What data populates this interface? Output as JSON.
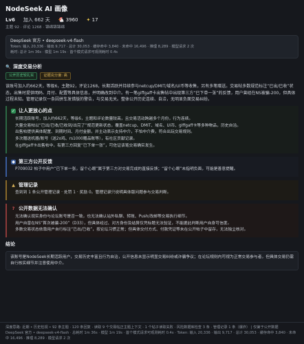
{
  "header": {
    "title": "NodeSeek AI 画像",
    "level": "Lv6",
    "joined": "加入 662 天",
    "chicken_icon": "🐔",
    "chicken_count": "3960",
    "star_count": "17",
    "subline": "主题 92 · 评论 1268 · 锦绵锦锦绵"
  },
  "model_card": {
    "line1": "DeepSeek 官方 • deepseek-v4-flash",
    "line2": "Token: 输入 20,336 · 输出 9,717 · 总计 30,053 · 缓存命中 3,840 · 未命中 16,496 · 推理 8,289 · 模型请求 2 次",
    "line3": "耗时: 总计 1m 36s · 模型 1m 19s · 首个模式请求可观测耗时 0.4s"
  },
  "analysis": {
    "heading": "深度交易分析",
    "tag1": "公开历史较扎实",
    "tag2": "证据充分度: 高",
    "paragraph": "该账号加入约662天，等级6，主题92，评论1268，长期活跃并持续参与netcup/DMIT/域名/Ui币等收售，另有多笔赠送。交易帖多数规范标注“已出/已收”状态，出售时提供明码、月付、配置等具体信息，并明确改到中介。有一笔giffgaff卡出售帖中出现第三方“已下单一张”的反馈，用户曾经在NS被骗-200，但具体过程未知。管理记录仅一条因拼车发错版的警告，与交易无关。整体公开历史连续、自洽，无明显负面交易纠纷。"
  },
  "positives": {
    "heading": "让人更放心的点",
    "items": [
      "长期活跃账号，加入约662天，等级6，主题和评论数量较高，且交易活动跨越多个月份，行为连续。",
      "大量交易帖以“已出/已收/已收到/出完了”规范更新状态，覆盖netcup、DMIT、域名、Ui币、giffgaff卡等多种物品，历史自洽。",
      "出售帖提供具体配置、到期时间、月付金额，并主动表示支持中介，不怕中介费，符合出玩交易规则。",
      "多次赠送机器/账号（送2o鸡、rs1000赠品账等），有社区贡献记录。",
      "在giffgaff卡出售帖中，有第三方回复“已下单一张”，可佐证该笔交易确实发生。"
    ]
  },
  "third_party": {
    "heading": "第三方公开反馈",
    "text": "P709032 帖子中用户“已下单一张，留个心眼”属于第三方对交易完成的直接反馈；“留个心眼”未指明负面，可能是善意提醒。"
  },
  "admin": {
    "heading": "管理记录",
    "text": "查到到 1 条公开管理记录 · 处罚 1 · 奖励 0。管理记录只说明具体版问题参与交易判断。"
  },
  "uncertain": {
    "heading": "公开数据无法确认",
    "items": [
      "无法确认现实身份与论坛账号是否一致，也无法确认站外私聊、转账、Push/改邮等交易执行细节。",
      "用户自曾在NS“首次被骗-200”（D33），但具体经过、对方身份及结算仅凭标题无法验证，不能据此判断用户自身可信度。",
      "多数交易状态依靠用户自行标注“已出/已收”，按论坛习惯正常；但具体交付方式、付款凭证等未在公开帖子中留存，无法独立核对。"
    ]
  },
  "conclusion": {
    "heading": "结论",
    "text": "该账号是NodeSeek长期活跃用户，交易历史丰富且行为自洽，公开信息未显示明显交易纠纷或诈骗争议；在论坛规则内可视为正常交易参与者，但具体交易仍需自行核实细节并注意使用中介。"
  },
  "footer": {
    "line1": "深度思路: 近期 • 历史检视 • 92 条主题 · 120 条回复 · 读取 9 个交易帖正主题上下文 · 1 个帖子读取失败 · 风险数据库检查 3 条 · 管理记录 1 条（爆炸） | 仅第于公开数据",
    "line2": "DeepSeek 官方 • deepseek-v4-flash · 总耗时 1m 36s · 模型 1m 19s · 首个模式请求可观测耗时 0.4s · Token: 输入 20,336 · 输出 9,717 · 总计 30,053 · 缓存命中 3,840 · 未命中 16,496 · 推理 8,289 · 模型请求 2 次"
  },
  "colors": {
    "background": "#16181d",
    "accent_green": "#5fc98b",
    "accent_yellow": "#d9b25a",
    "accent_blue": "#5b8de0"
  }
}
